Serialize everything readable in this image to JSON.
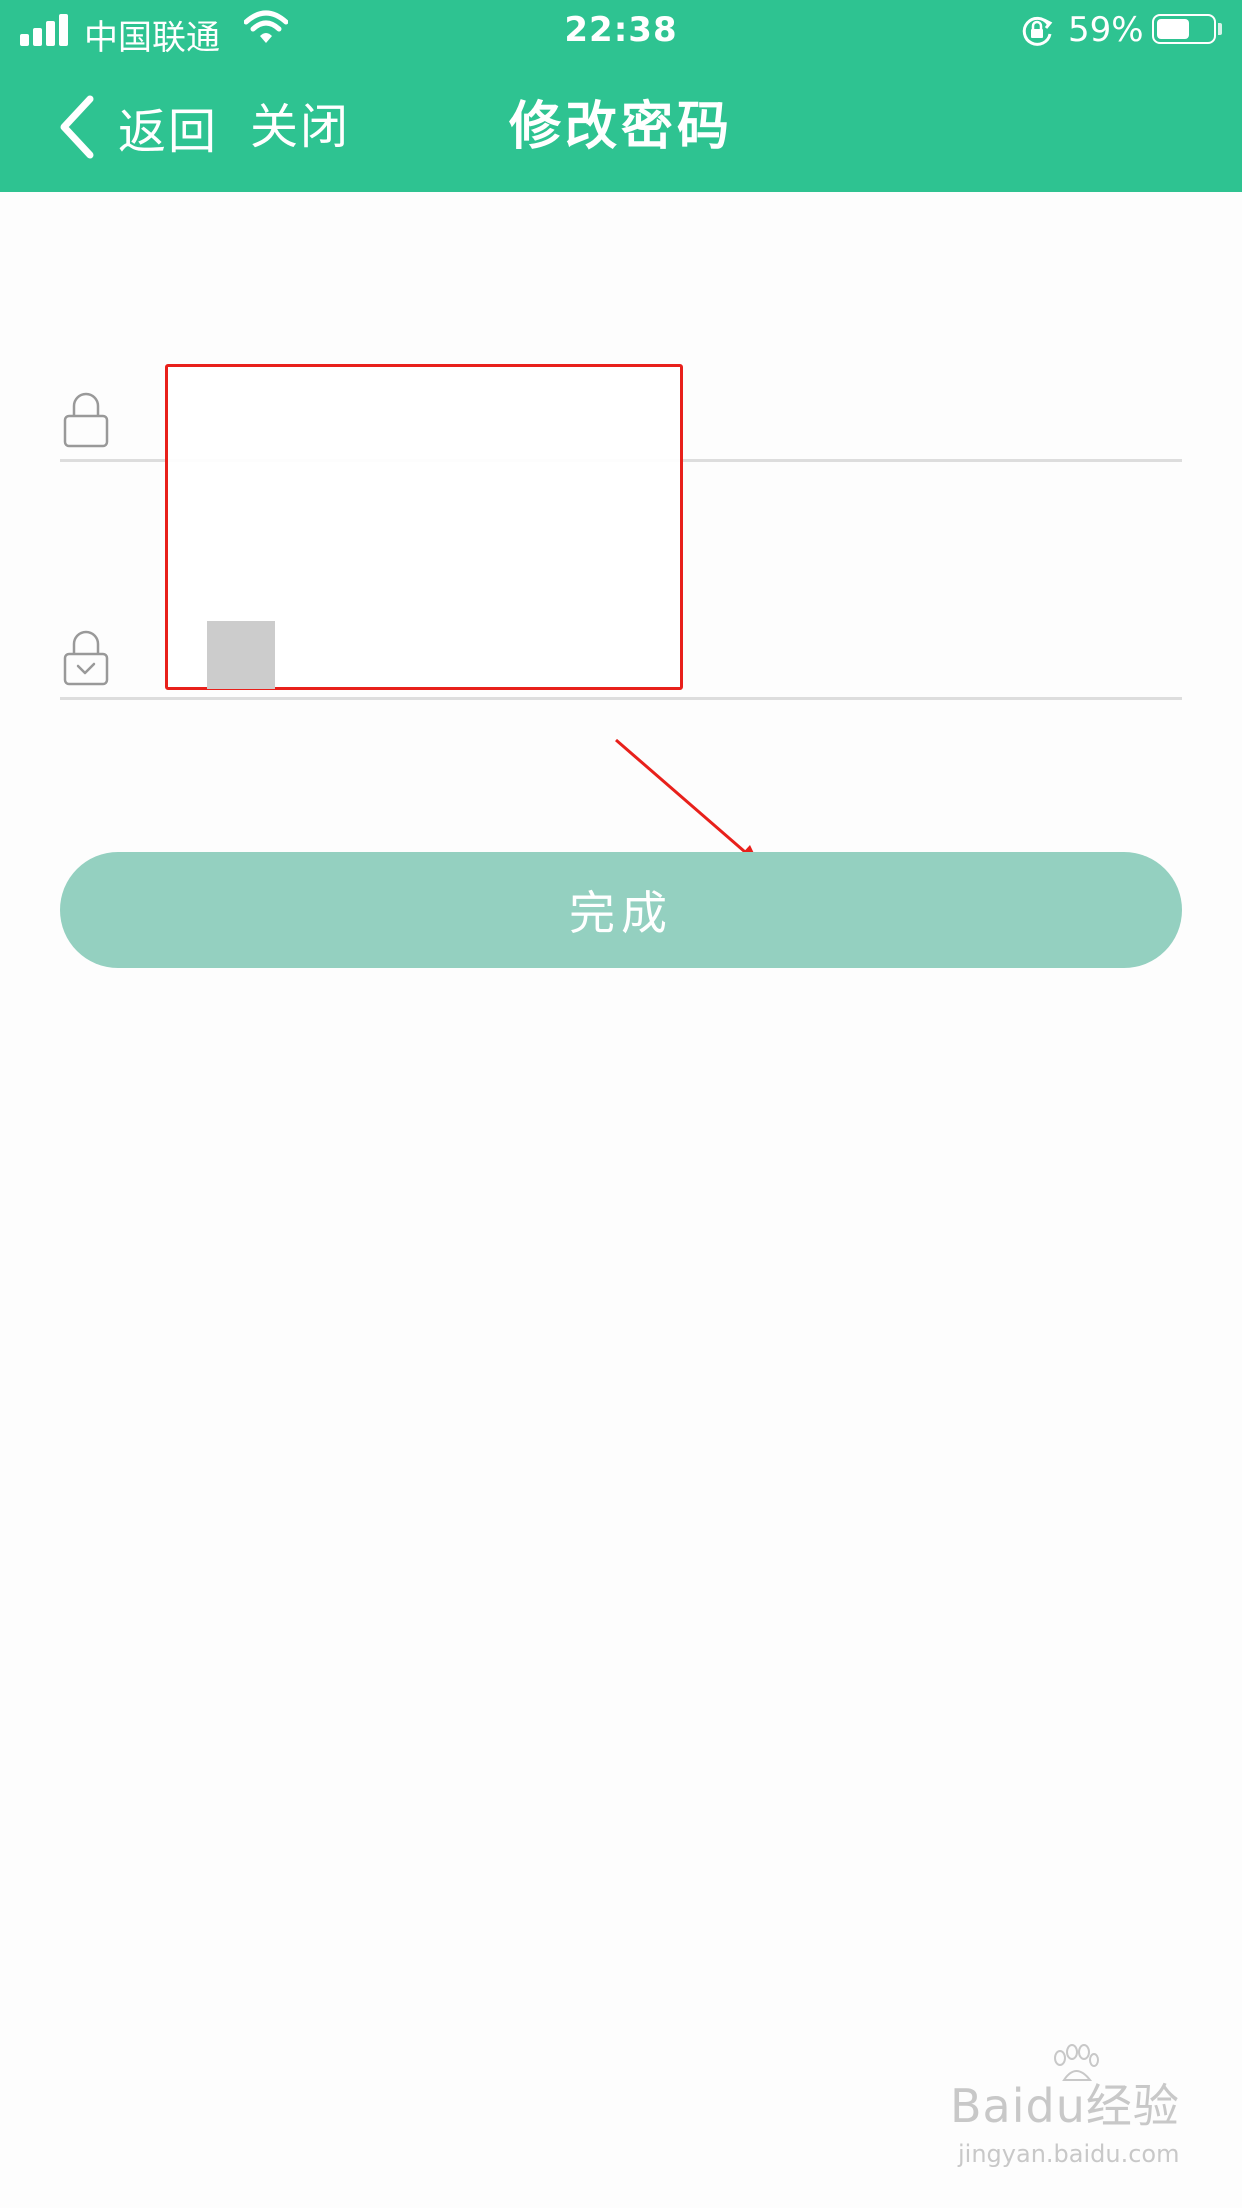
{
  "status_bar": {
    "carrier": "中国联通",
    "time": "22:38",
    "battery_percent": "59%",
    "battery_level": 0.59,
    "icons": [
      "signal-icon",
      "wifi-icon",
      "rotation-lock-icon",
      "battery-icon"
    ]
  },
  "nav": {
    "back_label": "返回",
    "close_label": "关闭",
    "title": "修改密码"
  },
  "form": {
    "password_field": {
      "value": "",
      "placeholder": ""
    },
    "confirm_field": {
      "value": "",
      "placeholder": ""
    },
    "submit_label": "完成"
  },
  "annotation": {
    "box_color": "#e8201b",
    "arrow_color": "#e8201b"
  },
  "watermark": {
    "main": "Baidu经验",
    "sub": "jingyan.baidu.com"
  },
  "colors": {
    "header": "#2ec391",
    "button": "#94d0c0",
    "divider": "#dddddd"
  }
}
